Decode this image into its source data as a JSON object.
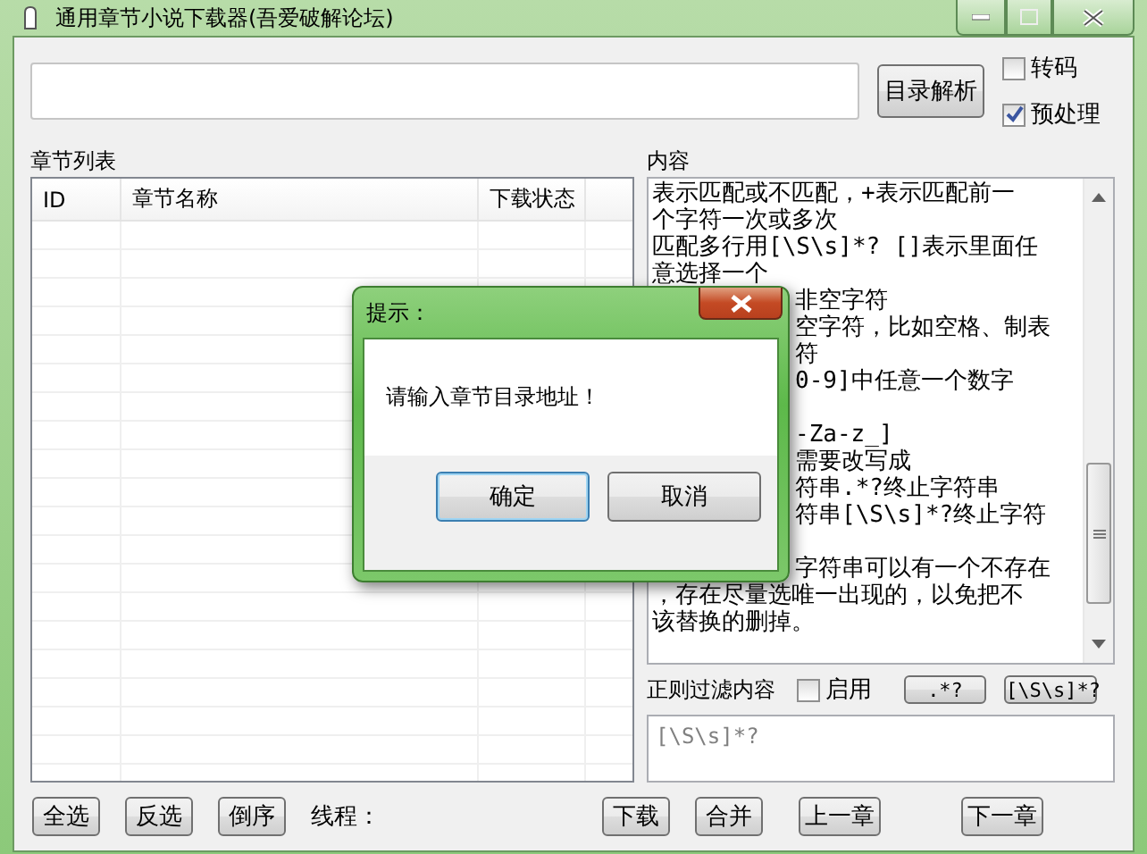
{
  "window": {
    "title": "通用章节小说下载器(吾爱破解论坛)"
  },
  "parse_button": "目录解析",
  "options": [
    {
      "label": "转码",
      "checked": false
    },
    {
      "label": "预处理",
      "checked": true
    }
  ],
  "chapter_list": {
    "label": "章节列表",
    "columns": [
      "ID",
      "章节名称",
      "下载状态"
    ]
  },
  "content": {
    "label": "内容",
    "lines": [
      {
        "kind": "full",
        "text": "表示匹配或不匹配，+表示匹配前一"
      },
      {
        "kind": "full",
        "text": "个字符一次或多次"
      },
      {
        "kind": "full",
        "text": "匹配多行用[\\S\\s]*? []表示里面任"
      },
      {
        "kind": "full",
        "text": "意选择一个"
      },
      {
        "kind": "tail",
        "text": "非空字符"
      },
      {
        "kind": "tail",
        "text": "空字符，比如空格、制表"
      },
      {
        "kind": "tail",
        "text": "符"
      },
      {
        "kind": "tail",
        "text": "0-9]中任意一个数字"
      },
      {
        "kind": "blank"
      },
      {
        "kind": "tail",
        "text": "-Za-z_]"
      },
      {
        "kind": "tail",
        "text": "需要改写成"
      },
      {
        "kind": "tail",
        "text": "符串.*?终止字符串"
      },
      {
        "kind": "tail",
        "text": "符串[\\S\\s]*?终止字符"
      },
      {
        "kind": "blank"
      },
      {
        "kind": "tail",
        "text": "字符串可以有一个不存在"
      },
      {
        "kind": "full",
        "text": "，存在尽量选唯一出现的，以免把不"
      },
      {
        "kind": "full",
        "text": "该替换的删掉。"
      }
    ]
  },
  "filter": {
    "label": "正则过滤内容",
    "enable": {
      "label": "启用",
      "checked": false
    },
    "buttons": [
      ".*?",
      "[\\S\\s]*?"
    ],
    "placeholder": "[\\S\\s]*?"
  },
  "bottom_buttons": [
    {
      "kind": "button",
      "label": "全选"
    },
    {
      "kind": "button",
      "label": "反选"
    },
    {
      "kind": "button",
      "label": "倒序"
    },
    {
      "kind": "label",
      "label": "线程："
    },
    {
      "kind": "button",
      "label": "下载"
    },
    {
      "kind": "button",
      "label": "合并"
    },
    {
      "kind": "button",
      "label": "上一章"
    },
    {
      "kind": "button",
      "label": "下一章"
    }
  ],
  "dialog": {
    "title": "提示：",
    "message": "请输入章节目录地址！",
    "buttons": [
      {
        "label": "确定",
        "selected": true
      },
      {
        "label": "取消",
        "selected": false
      }
    ]
  }
}
